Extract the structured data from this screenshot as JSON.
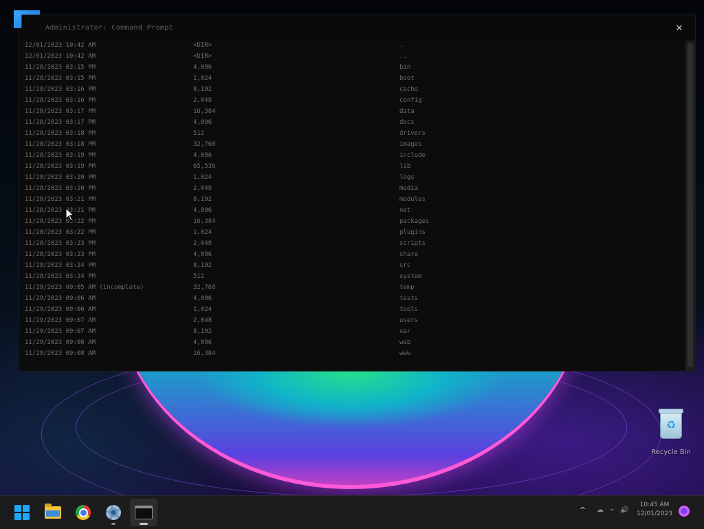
{
  "window": {
    "title": "Administrator: Command Prompt",
    "close_glyph": "✕",
    "rows": [
      [
        "12/01/2023 10:42 AM",
        "<DIR>",
        "",
        "."
      ],
      [
        "12/01/2023 10:42 AM",
        "<DIR>",
        "",
        ".."
      ],
      [
        "11/28/2023 03:15 PM",
        "4,096",
        "",
        "bin"
      ],
      [
        "11/28/2023 03:15 PM",
        "1,024",
        "",
        "boot"
      ],
      [
        "11/28/2023 03:16 PM",
        "8,192",
        "",
        "cache"
      ],
      [
        "11/28/2023 03:16 PM",
        "2,048",
        "",
        "config"
      ],
      [
        "11/28/2023 03:17 PM",
        "16,384",
        "",
        "data"
      ],
      [
        "11/28/2023 03:17 PM",
        "4,096",
        "",
        "docs"
      ],
      [
        "11/28/2023 03:18 PM",
        "512",
        "",
        "drivers"
      ],
      [
        "11/28/2023 03:18 PM",
        "32,768",
        "",
        "images"
      ],
      [
        "11/28/2023 03:19 PM",
        "4,096",
        "",
        "include"
      ],
      [
        "11/28/2023 03:19 PM",
        "65,536",
        "",
        "lib"
      ],
      [
        "11/28/2023 03:20 PM",
        "1,024",
        "",
        "logs"
      ],
      [
        "11/28/2023 03:20 PM",
        "2,048",
        "",
        "media"
      ],
      [
        "11/28/2023 03:21 PM",
        "8,192",
        "",
        "modules"
      ],
      [
        "11/28/2023 03:21 PM",
        "4,096",
        "",
        "net"
      ],
      [
        "11/28/2023 03:22 PM",
        "16,384",
        "",
        "packages"
      ],
      [
        "11/28/2023 03:22 PM",
        "1,024",
        "",
        "plugins"
      ],
      [
        "11/28/2023 03:23 PM",
        "2,048",
        "",
        "scripts"
      ],
      [
        "11/28/2023 03:23 PM",
        "4,096",
        "",
        "share"
      ],
      [
        "11/28/2023 03:24 PM",
        "8,192",
        "",
        "src"
      ],
      [
        "11/28/2023 03:24 PM",
        "512",
        "",
        "system"
      ],
      [
        "11/29/2023 09:05 AM   (incomplete)",
        "32,768",
        "",
        "temp"
      ],
      [
        "11/29/2023 09:06 AM",
        "4,096",
        "",
        "tests"
      ],
      [
        "11/29/2023 09:06 AM",
        "1,024",
        "",
        "tools"
      ],
      [
        "11/29/2023 09:07 AM",
        "2,048",
        "",
        "users"
      ],
      [
        "11/29/2023 09:07 AM",
        "8,192",
        "",
        "var"
      ],
      [
        "11/29/2023 09:08 AM",
        "4,096",
        "",
        "web"
      ],
      [
        "11/29/2023 09:08 AM",
        "16,384",
        "",
        "www"
      ]
    ]
  },
  "desktop": {
    "recycle_bin_label": "Recycle Bin"
  },
  "taskbar": {
    "apps": [
      {
        "name": "start",
        "icon": "windows-start-icon"
      },
      {
        "name": "file-explorer",
        "icon": "folder-icon"
      },
      {
        "name": "chrome",
        "icon": "chrome-icon"
      },
      {
        "name": "settings",
        "icon": "gear-icon"
      },
      {
        "name": "terminal",
        "icon": "terminal-icon"
      }
    ],
    "tray_chevron": "^",
    "tray_icons": "☁ ⌁ 🔊",
    "clock_time": "10:45 AM",
    "clock_date": "12/01/2023"
  },
  "colors": {
    "accent": "#1fa5f5",
    "terminal_bg": "#0c0c0c",
    "taskbar_bg": "#1c1c1c"
  }
}
